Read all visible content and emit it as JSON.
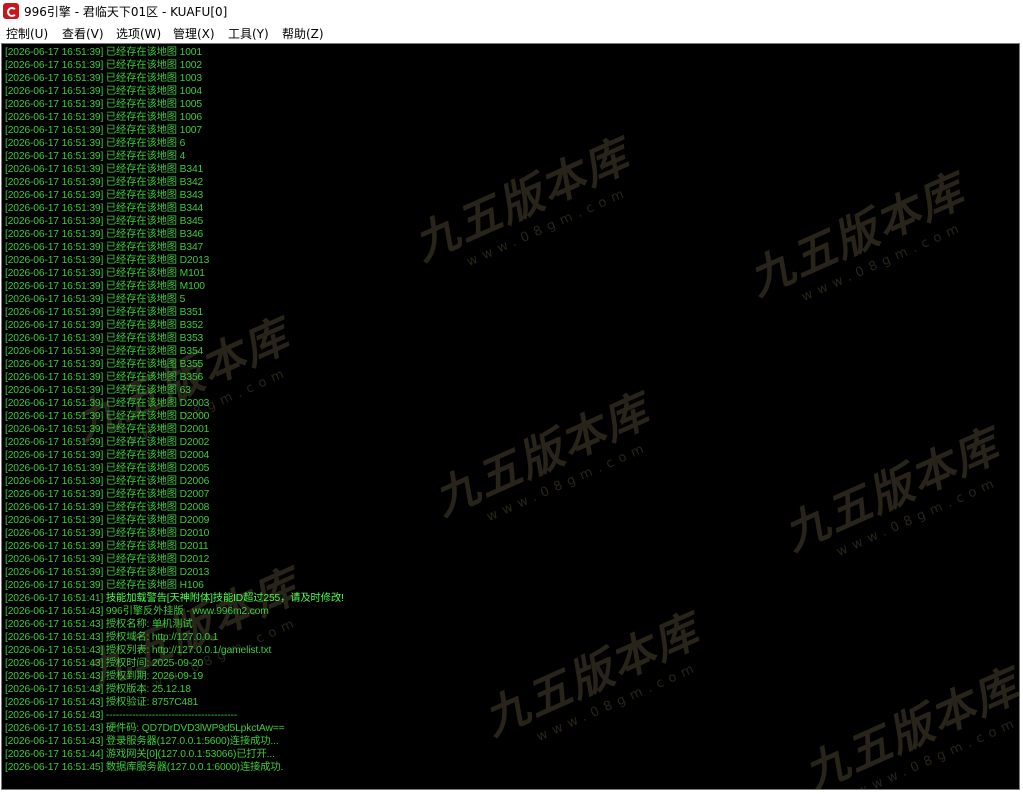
{
  "window": {
    "title": "996引擎 - 君临天下01区 - KUAFU[0]",
    "icon": "app-logo-icon"
  },
  "menu": [
    {
      "label": "控制(U)",
      "id": "control"
    },
    {
      "label": "查看(V)",
      "id": "view"
    },
    {
      "label": "选项(W)",
      "id": "options"
    },
    {
      "label": "管理(X)",
      "id": "manage"
    },
    {
      "label": "工具(Y)",
      "id": "tools"
    },
    {
      "label": "帮助(Z)",
      "id": "help"
    }
  ],
  "watermark": {
    "main": "九五版本库",
    "sub": "www.08gm.com"
  },
  "log": [
    {
      "ts": "[2026-06-17 16:51:39]",
      "msg": "已经存在该地图 1001"
    },
    {
      "ts": "[2026-06-17 16:51:39]",
      "msg": "已经存在该地图 1002"
    },
    {
      "ts": "[2026-06-17 16:51:39]",
      "msg": "已经存在该地图 1003"
    },
    {
      "ts": "[2026-06-17 16:51:39]",
      "msg": "已经存在该地图 1004"
    },
    {
      "ts": "[2026-06-17 16:51:39]",
      "msg": "已经存在该地图 1005"
    },
    {
      "ts": "[2026-06-17 16:51:39]",
      "msg": "已经存在该地图 1006"
    },
    {
      "ts": "[2026-06-17 16:51:39]",
      "msg": "已经存在该地图 1007"
    },
    {
      "ts": "[2026-06-17 16:51:39]",
      "msg": "已经存在该地图 6"
    },
    {
      "ts": "[2026-06-17 16:51:39]",
      "msg": "已经存在该地图 4"
    },
    {
      "ts": "[2026-06-17 16:51:39]",
      "msg": "已经存在该地图 B341"
    },
    {
      "ts": "[2026-06-17 16:51:39]",
      "msg": "已经存在该地图 B342"
    },
    {
      "ts": "[2026-06-17 16:51:39]",
      "msg": "已经存在该地图 B343"
    },
    {
      "ts": "[2026-06-17 16:51:39]",
      "msg": "已经存在该地图 B344"
    },
    {
      "ts": "[2026-06-17 16:51:39]",
      "msg": "已经存在该地图 B345"
    },
    {
      "ts": "[2026-06-17 16:51:39]",
      "msg": "已经存在该地图 B346"
    },
    {
      "ts": "[2026-06-17 16:51:39]",
      "msg": "已经存在该地图 B347"
    },
    {
      "ts": "[2026-06-17 16:51:39]",
      "msg": "已经存在该地图 D2013"
    },
    {
      "ts": "[2026-06-17 16:51:39]",
      "msg": "已经存在该地图 M101"
    },
    {
      "ts": "[2026-06-17 16:51:39]",
      "msg": "已经存在该地图 M100"
    },
    {
      "ts": "[2026-06-17 16:51:39]",
      "msg": "已经存在该地图 5"
    },
    {
      "ts": "[2026-06-17 16:51:39]",
      "msg": "已经存在该地图 B351"
    },
    {
      "ts": "[2026-06-17 16:51:39]",
      "msg": "已经存在该地图 B352"
    },
    {
      "ts": "[2026-06-17 16:51:39]",
      "msg": "已经存在该地图 B353"
    },
    {
      "ts": "[2026-06-17 16:51:39]",
      "msg": "已经存在该地图 B354"
    },
    {
      "ts": "[2026-06-17 16:51:39]",
      "msg": "已经存在该地图 B355"
    },
    {
      "ts": "[2026-06-17 16:51:39]",
      "msg": "已经存在该地图 B356"
    },
    {
      "ts": "[2026-06-17 16:51:39]",
      "msg": "已经存在该地图 63"
    },
    {
      "ts": "[2026-06-17 16:51:39]",
      "msg": "已经存在该地图 D2003"
    },
    {
      "ts": "[2026-06-17 16:51:39]",
      "msg": "已经存在该地图 D2000"
    },
    {
      "ts": "[2026-06-17 16:51:39]",
      "msg": "已经存在该地图 D2001"
    },
    {
      "ts": "[2026-06-17 16:51:39]",
      "msg": "已经存在该地图 D2002"
    },
    {
      "ts": "[2026-06-17 16:51:39]",
      "msg": "已经存在该地图 D2004"
    },
    {
      "ts": "[2026-06-17 16:51:39]",
      "msg": "已经存在该地图 D2005"
    },
    {
      "ts": "[2026-06-17 16:51:39]",
      "msg": "已经存在该地图 D2006"
    },
    {
      "ts": "[2026-06-17 16:51:39]",
      "msg": "已经存在该地图 D2007"
    },
    {
      "ts": "[2026-06-17 16:51:39]",
      "msg": "已经存在该地图 D2008"
    },
    {
      "ts": "[2026-06-17 16:51:39]",
      "msg": "已经存在该地图 D2009"
    },
    {
      "ts": "[2026-06-17 16:51:39]",
      "msg": "已经存在该地图 D2010"
    },
    {
      "ts": "[2026-06-17 16:51:39]",
      "msg": "已经存在该地图 D2011"
    },
    {
      "ts": "[2026-06-17 16:51:39]",
      "msg": "已经存在该地图 D2012"
    },
    {
      "ts": "[2026-06-17 16:51:39]",
      "msg": "已经存在该地图 D2013"
    },
    {
      "ts": "[2026-06-17 16:51:39]",
      "msg": "已经存在该地图 H106"
    },
    {
      "ts": "[2026-06-17 16:51:41]",
      "msg": "技能加载警告[天神附体]技能ID超过255，请及时修改!",
      "warn": true
    },
    {
      "ts": "[2026-06-17 16:51:43]",
      "msg": "996引擎反外挂版 - www.996m2.com"
    },
    {
      "ts": "[2026-06-17 16:51:43]",
      "msg": "授权名称: 单机测试"
    },
    {
      "ts": "[2026-06-17 16:51:43]",
      "msg": "授权域名: http://127.0.0.1"
    },
    {
      "ts": "[2026-06-17 16:51:43]",
      "msg": "授权列表: http://127.0.0.1/gamelist.txt"
    },
    {
      "ts": "[2026-06-17 16:51:43]",
      "msg": "授权时间: 2025-09-20"
    },
    {
      "ts": "[2026-06-17 16:51:43]",
      "msg": "授权到期: 2026-09-19"
    },
    {
      "ts": "[2026-06-17 16:51:43]",
      "msg": "授权版本: 25.12.18"
    },
    {
      "ts": "[2026-06-17 16:51:43]",
      "msg": "授权验证: 8757C481"
    },
    {
      "ts": "[2026-06-17 16:51:43]",
      "msg": "----------------------------------------"
    },
    {
      "ts": "[2026-06-17 16:51:43]",
      "msg": "硬件码: QD7DrDVD3lWP9d5LpkctAw=="
    },
    {
      "ts": "[2026-06-17 16:51:43]",
      "msg": "登录服务器(127.0.0.1:5600)连接成功..."
    },
    {
      "ts": "[2026-06-17 16:51:44]",
      "msg": "游戏网关[0](127.0.0.1:53066)已打开..."
    },
    {
      "ts": "[2026-06-17 16:51:45]",
      "msg": "数据库服务器(127.0.0.1:6000)连接成功."
    }
  ]
}
